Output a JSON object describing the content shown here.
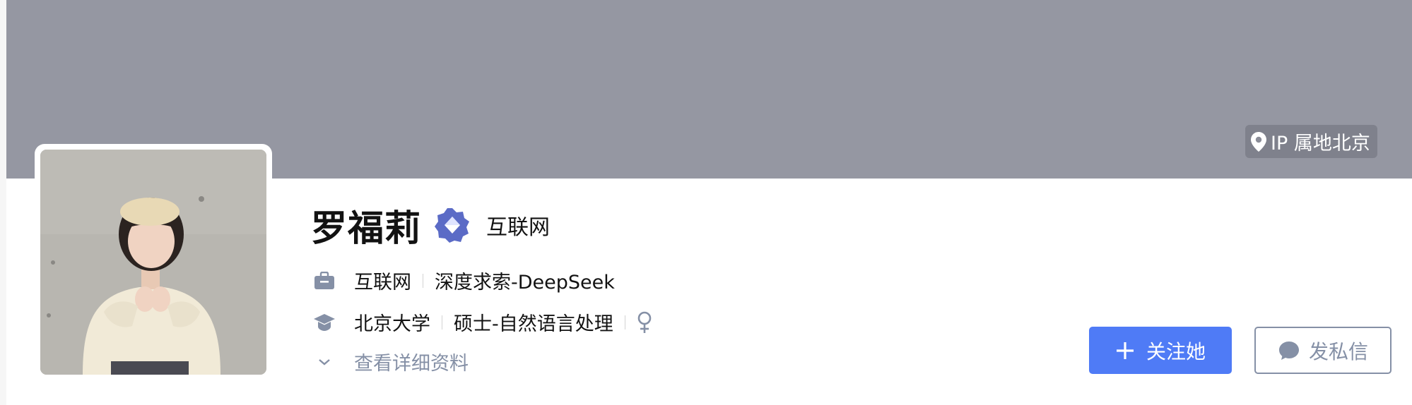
{
  "banner": {
    "ip_location": "IP 属地北京"
  },
  "profile": {
    "name": "罗福莉",
    "headline": "互联网",
    "work": {
      "industry": "互联网",
      "company": "深度求索-DeepSeek"
    },
    "education": {
      "school": "北京大学",
      "degree": "硕士-自然语言处理"
    },
    "gender_icon": "female-icon",
    "more_info_label": "查看详细资料"
  },
  "actions": {
    "follow_label": "关注她",
    "message_label": "发私信"
  },
  "colors": {
    "banner": "#9597a2",
    "primary": "#4f7bf6",
    "secondary_text": "#8590a6",
    "verified_badge": "#5b6bc6"
  }
}
